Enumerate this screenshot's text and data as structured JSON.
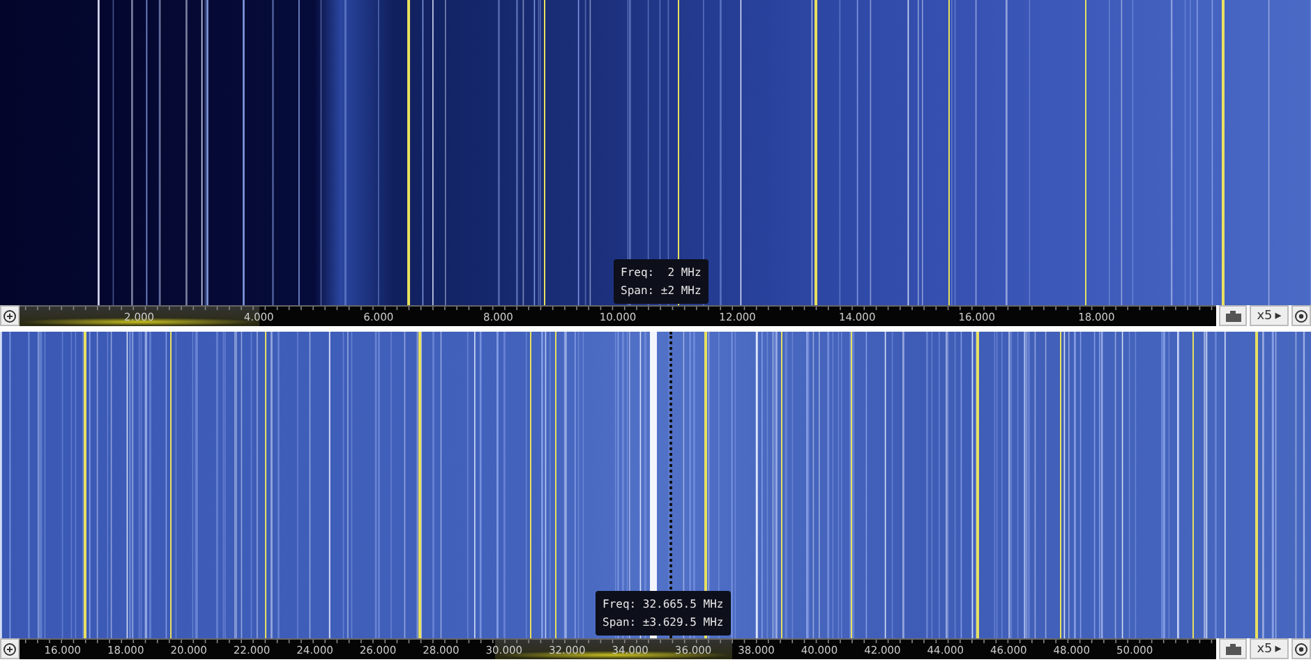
{
  "panels": [
    {
      "tooltip": {
        "freq": "Freq:  2 MHz",
        "span": "Span: ±2 MHz"
      },
      "scale_labels": [
        "2.000",
        "4.000",
        "6.000",
        "8.000",
        "10.000",
        "12.000",
        "14.000",
        "16.000",
        "18.000"
      ],
      "zoom": "x5",
      "zoom_arrow": "▸"
    },
    {
      "tooltip": {
        "freq": "Freq: 32.665.5 MHz",
        "span": "Span: ±3.629.5 MHz"
      },
      "scale_labels": [
        "16.000",
        "18.000",
        "20.000",
        "22.000",
        "24.000",
        "26.000",
        "28.000",
        "30.000",
        "32.000",
        "34.000",
        "36.000",
        "38.000",
        "40.000",
        "42.000",
        "44.000",
        "46.000",
        "48.000",
        "50.000"
      ],
      "zoom": "x5",
      "zoom_arrow": "▸"
    }
  ]
}
